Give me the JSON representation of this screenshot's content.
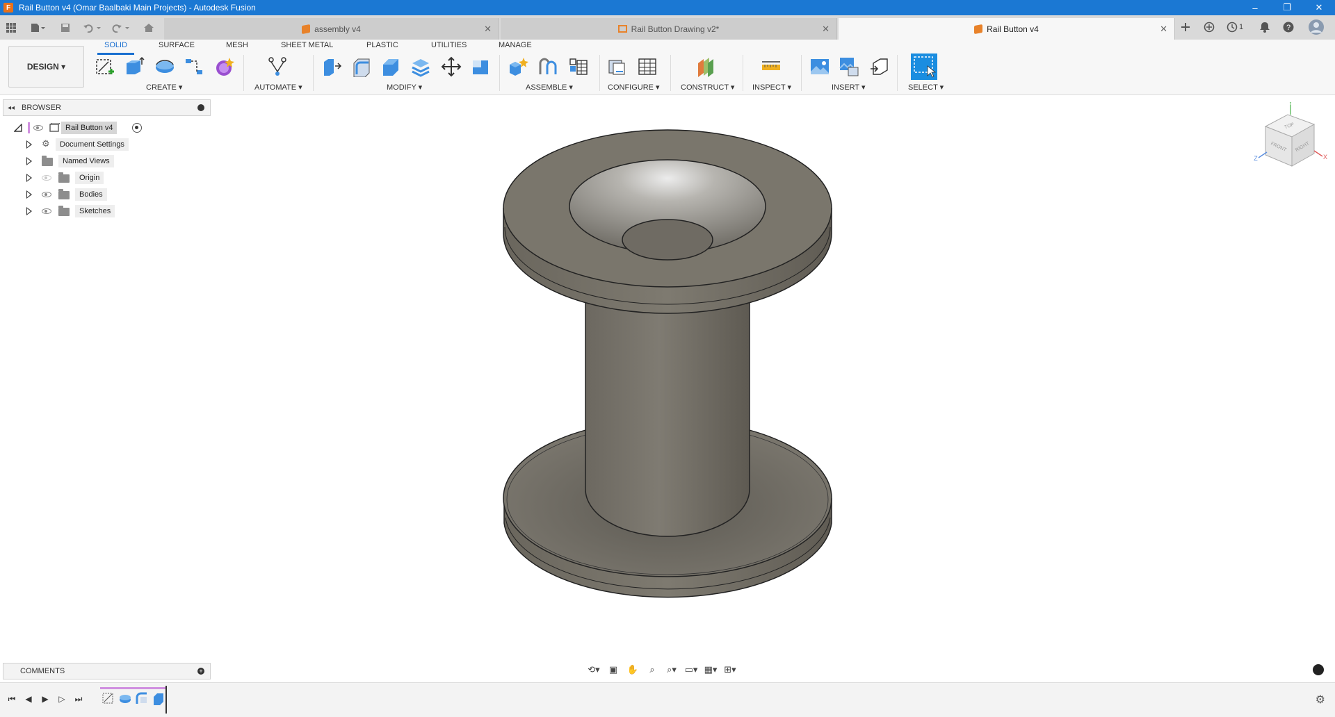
{
  "window": {
    "title": "Rail Button v4 (Omar Baalbaki Main Projects) - Autodesk Fusion",
    "app_icon_letter": "F",
    "controls": [
      "–",
      "❐",
      "✕"
    ]
  },
  "tabs": [
    {
      "label": "assembly v4",
      "icon": "part-cube-icon",
      "active": false
    },
    {
      "label": "Rail Button Drawing v2*",
      "icon": "drawing-icon",
      "active": false
    },
    {
      "label": "Rail Button v4",
      "icon": "part-cube-icon",
      "active": true
    }
  ],
  "tabbar_right": {
    "job_count": "1"
  },
  "workspace": {
    "label": "DESIGN ▾"
  },
  "ribbon_tabs": [
    {
      "label": "SOLID",
      "active": true
    },
    {
      "label": "SURFACE",
      "active": false
    },
    {
      "label": "MESH",
      "active": false
    },
    {
      "label": "SHEET METAL",
      "active": false
    },
    {
      "label": "PLASTIC",
      "active": false
    },
    {
      "label": "UTILITIES",
      "active": false
    },
    {
      "label": "MANAGE",
      "active": false
    }
  ],
  "ribbon_groups": [
    {
      "label": "CREATE ▾"
    },
    {
      "label": "AUTOMATE ▾"
    },
    {
      "label": "MODIFY ▾"
    },
    {
      "label": "ASSEMBLE ▾"
    },
    {
      "label": "CONFIGURE ▾"
    },
    {
      "label": "CONSTRUCT ▾"
    },
    {
      "label": "INSPECT ▾"
    },
    {
      "label": "INSERT ▾"
    },
    {
      "label": "SELECT ▾"
    }
  ],
  "browser": {
    "title": "BROWSER",
    "root": "Rail Button v4",
    "items": [
      {
        "label": "Document Settings",
        "icon": "gear-icon"
      },
      {
        "label": "Named Views",
        "icon": "folder-icon"
      },
      {
        "label": "Origin",
        "icon": "folder-icon",
        "visible": false
      },
      {
        "label": "Bodies",
        "icon": "folder-icon",
        "visible": true
      },
      {
        "label": "Sketches",
        "icon": "folder-icon",
        "visible": true
      }
    ]
  },
  "viewcube": {
    "top": "TOP",
    "front": "FRONT",
    "right": "RIGHT",
    "axis_x": "X",
    "axis_y": "Y",
    "axis_z": "Z"
  },
  "comments": {
    "title": "COMMENTS"
  },
  "colors": {
    "titlebar": "#1b78d3",
    "accent": "#1a6fd0",
    "part_body": "#7a766c",
    "tab_icon": "#e8822a"
  }
}
